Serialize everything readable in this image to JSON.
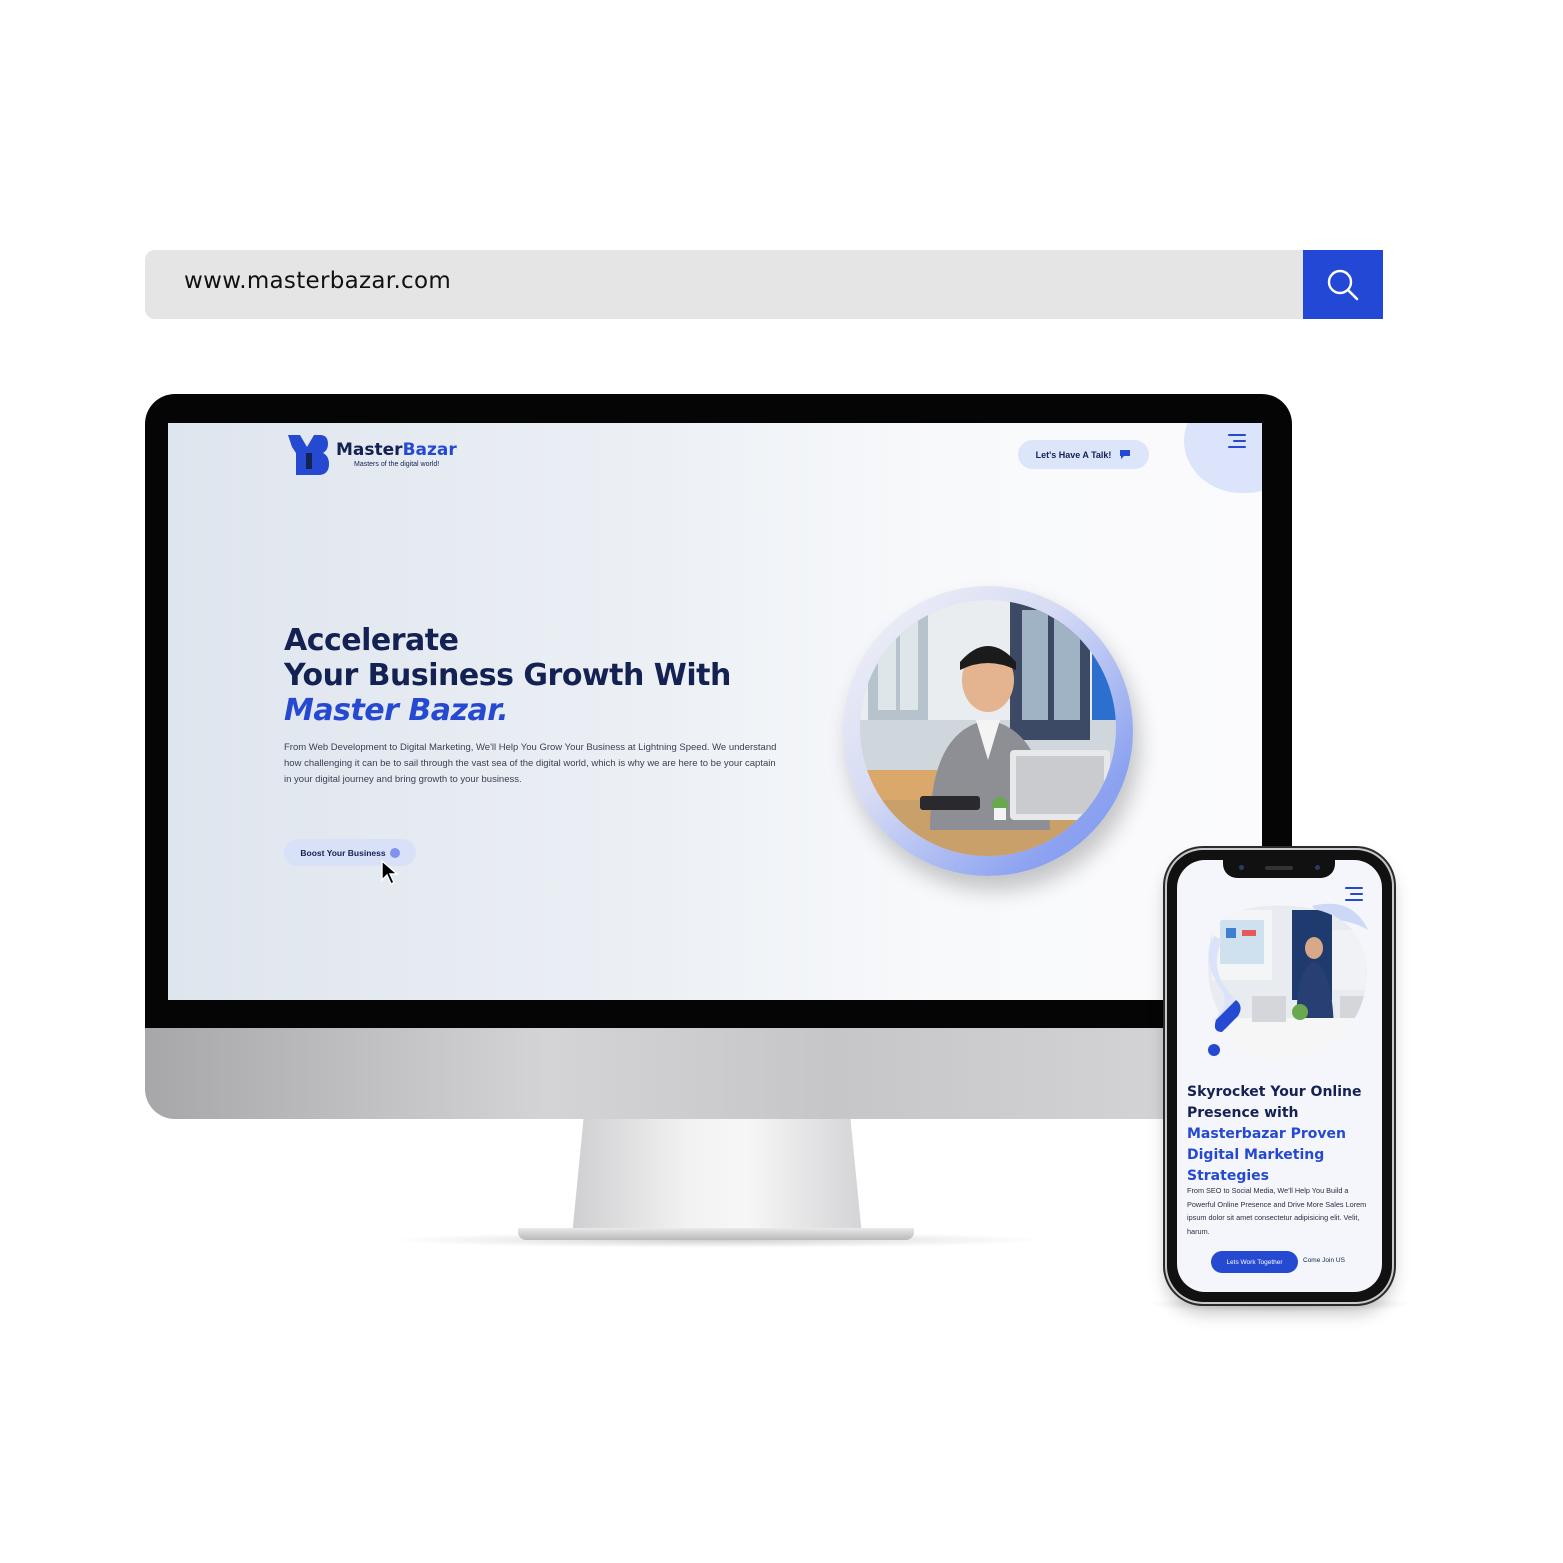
{
  "browser": {
    "url": "www.masterbazar.com",
    "search_icon": "search-icon"
  },
  "desktop_site": {
    "logo": {
      "name_part1": "Master",
      "name_part2": "Bazar",
      "tagline": "Masters of the digital world!"
    },
    "talk_button": {
      "label": "Let's Have A Talk!",
      "icon": "chat-bubble-icon"
    },
    "menu_icon": "hamburger-menu-icon",
    "hero": {
      "heading_line1": "Accelerate",
      "heading_line2": "Your Business Growth With",
      "heading_highlight": "Master Bazar.",
      "description": "From Web Development to Digital Marketing, We'll Help You Grow Your Business at Lightning Speed. We understand how challenging it can be to sail through the vast sea of the digital world, which is why we are here to be your captain in your digital journey and bring growth to your business.",
      "cta_label": "Boost Your Business",
      "image": "businessman-at-laptop-photo"
    }
  },
  "mobile_site": {
    "menu_icon": "hamburger-menu-icon",
    "image": "office-meeting-photo",
    "heading_line1": "Skyrocket Your Online Presence with",
    "heading_highlight": "Masterbazar Proven Digital Marketing Strategies",
    "description": "From SEO to Social Media, We'll Help You Build a Powerful Online Presence and Drive More Sales Lorem ipsum dolor sit amet consectetur adipisicing elit. Velit, harum.",
    "cta_label": "Lets Work Together",
    "secondary_link": "Come Join US"
  },
  "colors": {
    "brand_blue": "#2549d0",
    "navy": "#142253",
    "search_button": "#2448d6"
  }
}
